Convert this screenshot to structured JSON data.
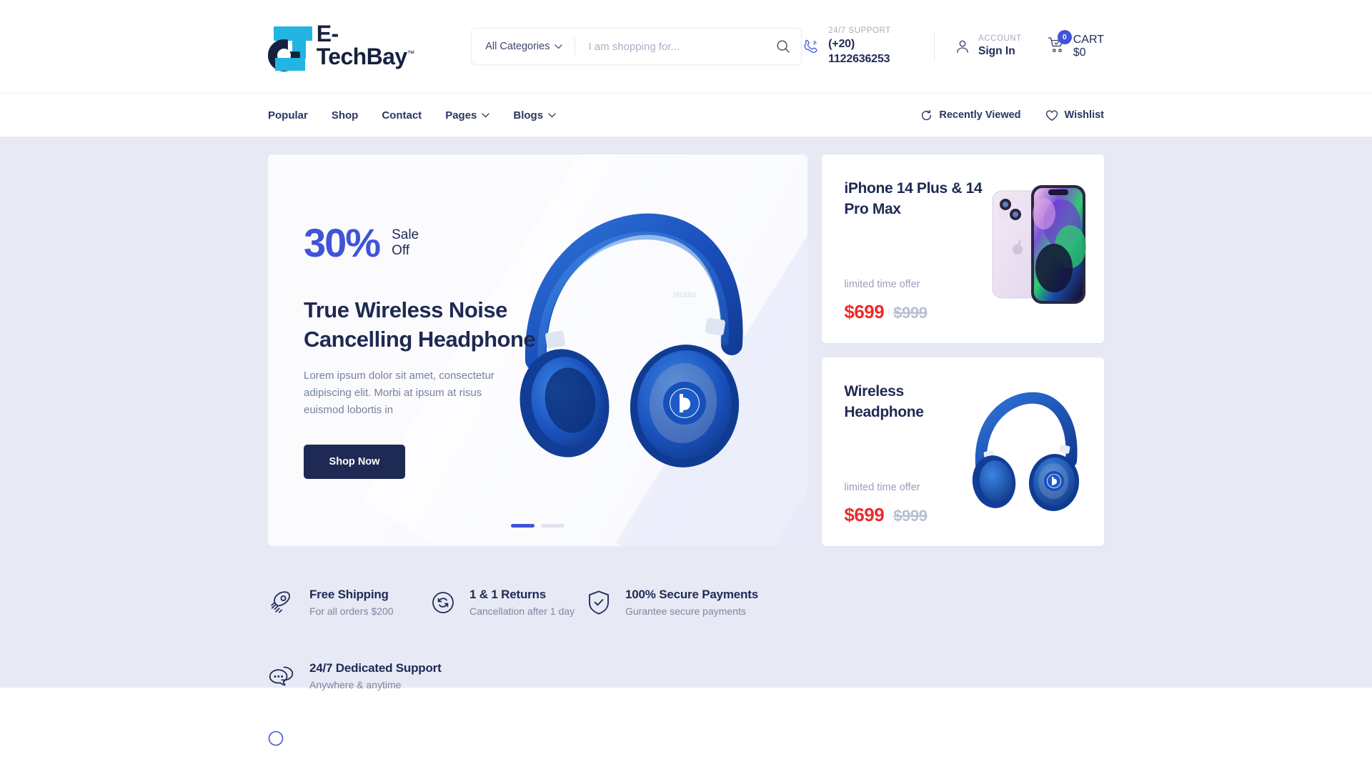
{
  "brand": {
    "name": "E-TechBay",
    "tm": "™"
  },
  "search": {
    "category_label": "All Categories",
    "placeholder": "I am shopping for...",
    "value": ""
  },
  "header": {
    "support_label": "24/7 SUPPORT",
    "support_phone": "(+20) 1122636253",
    "account_label": "ACCOUNT",
    "account_value": "Sign In",
    "cart_label": "CART",
    "cart_total": "$0",
    "cart_count": "0"
  },
  "nav": {
    "items": [
      {
        "label": "Popular",
        "caret": false
      },
      {
        "label": "Shop",
        "caret": false
      },
      {
        "label": "Contact",
        "caret": false
      },
      {
        "label": "Pages",
        "caret": true
      },
      {
        "label": "Blogs",
        "caret": true
      }
    ],
    "recently_viewed": "Recently Viewed",
    "wishlist": "Wishlist"
  },
  "slider": {
    "sale_percent": "30%",
    "sale_line1": "Sale",
    "sale_line2": "Off",
    "title": "True Wireless Noise Cancelling Headphone",
    "description": "Lorem ipsum dolor sit amet, consectetur adipiscing elit. Morbi at ipsum at risus euismod lobortis in",
    "cta": "Shop Now",
    "dots": 2,
    "active_dot": 0
  },
  "promos": [
    {
      "title": "iPhone 14 Plus & 14 Pro Max",
      "offer_label": "limited time offer",
      "price_new": "$699",
      "price_old": "$999",
      "image": "iphone-14"
    },
    {
      "title": "Wireless Headphone",
      "offer_label": "limited time offer",
      "price_new": "$699",
      "price_old": "$999",
      "image": "blue-headphone"
    }
  ],
  "features": [
    {
      "icon": "rocket-icon",
      "title": "Free Shipping",
      "sub": "For all orders $200"
    },
    {
      "icon": "returns-icon",
      "title": "1 & 1 Returns",
      "sub": "Cancellation after 1 day"
    },
    {
      "icon": "shield-check-icon",
      "title": "100% Secure Payments",
      "sub": "Gurantee secure payments"
    },
    {
      "icon": "chat-support-icon",
      "title": "24/7 Dedicated Support",
      "sub": "Anywhere & anytime"
    }
  ],
  "colors": {
    "accent_blue": "#4053d9",
    "navy": "#222b54",
    "logo_cyan": "#22b5e2",
    "price_red": "#ee2b2b",
    "hero_bg": "#e7eaf5"
  }
}
